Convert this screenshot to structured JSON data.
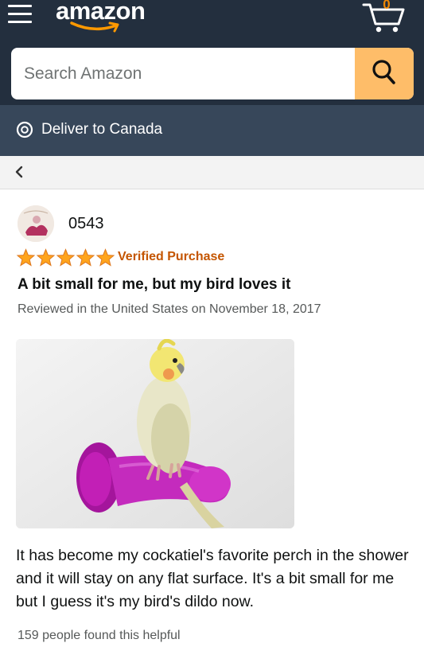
{
  "header": {
    "logo": "amazon",
    "cart_count": "0",
    "search": {
      "placeholder": "Search Amazon"
    },
    "deliver_to": "Deliver to Canada",
    "icons": [
      "menu-icon",
      "cart-icon",
      "search-icon",
      "location-pin-icon",
      "chevron-left-icon"
    ],
    "colors": {
      "nav_bg": "#232f3e",
      "subnav_bg": "#37475a",
      "search_button": "#febd69",
      "cart_count": "#f08804"
    }
  },
  "review": {
    "username": "0543",
    "rating": 5,
    "verified_label": "Verified Purchase",
    "title": "A bit small for me, but my bird loves it",
    "date": "Reviewed in the United States on November 18, 2017",
    "body": "It has become my cockatiel's favorite perch in the shower and it will stay on any flat surface. It's a bit small for me but I guess it's my bird's dildo now.",
    "helpful": "159 people found this helpful",
    "colors": {
      "star": "#ffa41c",
      "verified": "#c45500"
    }
  }
}
